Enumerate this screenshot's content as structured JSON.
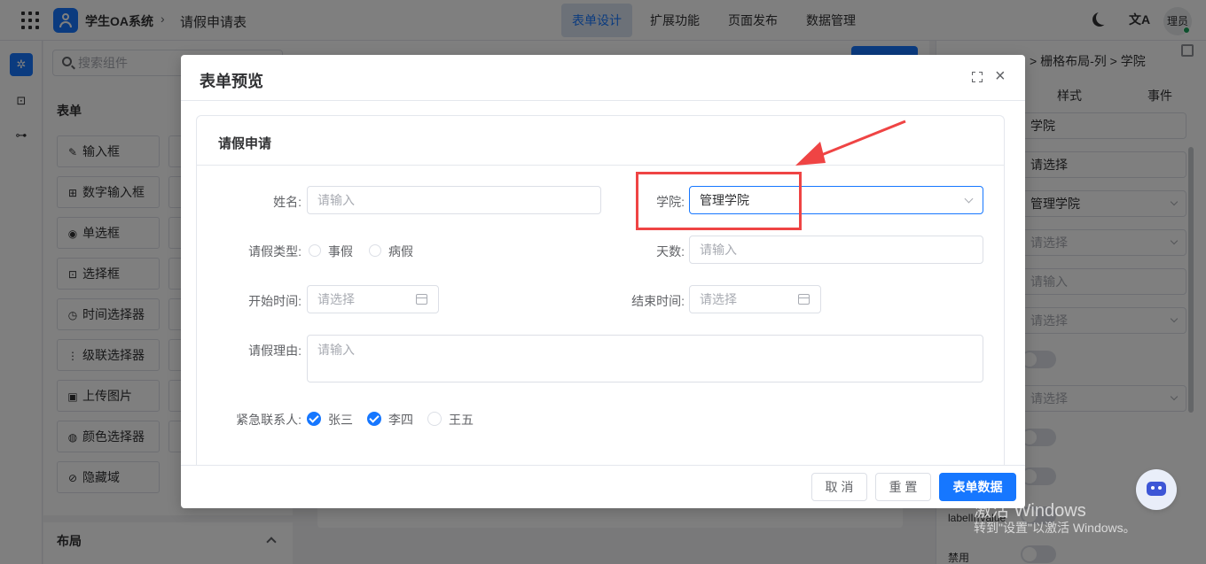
{
  "header": {
    "app_name": "学生OA系统",
    "separator": "›",
    "page_title": "请假申请表",
    "tabs": [
      {
        "label": "表单设计",
        "active": true
      },
      {
        "label": "扩展功能",
        "active": false
      },
      {
        "label": "页面发布",
        "active": false
      },
      {
        "label": "数据管理",
        "active": false
      }
    ],
    "lang_icon": "文A",
    "user_avatar": "理员"
  },
  "components_panel": {
    "search_placeholder": "搜索组件",
    "section_form": "表单",
    "items": [
      {
        "label": "输入框",
        "icon": "✎"
      },
      {
        "label": "数字输入框",
        "icon": "⊞"
      },
      {
        "label": "单选框",
        "icon": "◉"
      },
      {
        "label": "选择框",
        "icon": "⊡"
      },
      {
        "label": "时间选择器",
        "icon": "◷"
      },
      {
        "label": "级联选择器",
        "icon": "⋮"
      },
      {
        "label": "上传图片",
        "icon": "▣"
      },
      {
        "label": "颜色选择器",
        "icon": "◍"
      },
      {
        "label": "隐藏域",
        "icon": "⊘"
      }
    ],
    "section_layout": "布局"
  },
  "properties_panel": {
    "breadcrumb": [
      "栅格布局-列",
      "学院"
    ],
    "crumb_sep": ">",
    "tabs": [
      "样式",
      "事件"
    ],
    "fields": [
      {
        "value": "学院",
        "placeholder": false,
        "select": false
      },
      {
        "value": "请选择",
        "placeholder": false,
        "select": false
      },
      {
        "value": "管理学院",
        "placeholder": false,
        "select": true
      },
      {
        "value": "请选择",
        "placeholder": true,
        "select": true
      },
      {
        "value": "请输入",
        "placeholder": true,
        "select": false
      },
      {
        "value": "请选择",
        "placeholder": true,
        "select": true
      }
    ],
    "field_after_toggle": {
      "value": "请选择",
      "placeholder": true
    },
    "label_in_value": "labelInValue",
    "disabled_label": "禁用"
  },
  "modal": {
    "title": "表单预览",
    "card_title": "请假申请",
    "name_label": "姓名:",
    "name_placeholder": "请输入",
    "college_label": "学院:",
    "college_value": "管理学院",
    "leave_type_label": "请假类型:",
    "leave_type_options": [
      "事假",
      "病假"
    ],
    "days_label": "天数:",
    "days_placeholder": "请输入",
    "start_label": "开始时间:",
    "start_placeholder": "请选择",
    "end_label": "结束时间:",
    "end_placeholder": "请选择",
    "reason_label": "请假理由:",
    "reason_placeholder": "请输入",
    "contact_label": "紧急联系人:",
    "contacts": [
      {
        "name": "张三",
        "checked": true
      },
      {
        "name": "李四",
        "checked": true
      },
      {
        "name": "王五",
        "checked": false
      }
    ],
    "buttons": {
      "cancel": "取 消",
      "reset": "重 置",
      "submit": "表单数据"
    }
  },
  "annotation": {
    "color": "#ef4444"
  },
  "watermark": {
    "line1": "激活 Windows",
    "line2": "转到\"设置\"以激活 Windows。"
  },
  "colors": {
    "primary": "#1677ff",
    "annotation": "#ef4444"
  }
}
